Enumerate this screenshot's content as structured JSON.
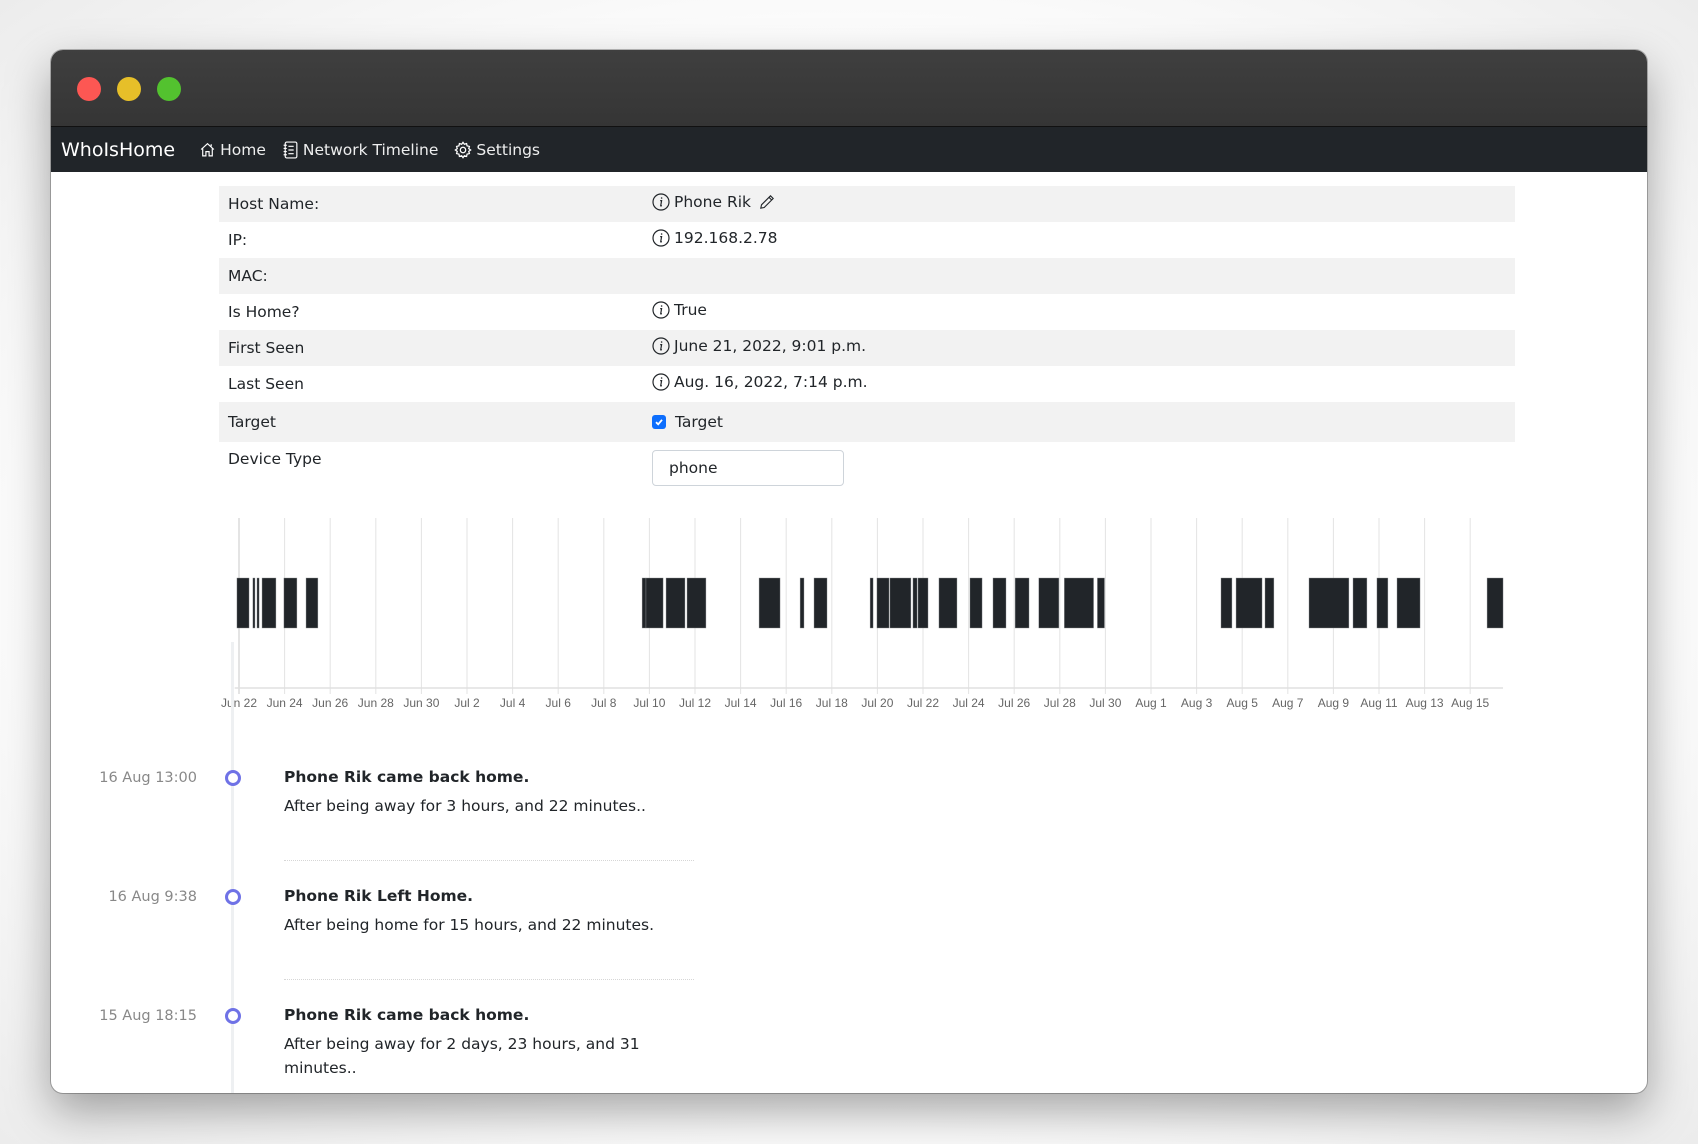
{
  "window": {
    "traffic_lights": [
      "close",
      "minimize",
      "maximize"
    ]
  },
  "navbar": {
    "brand": "WhoIsHome",
    "items": [
      {
        "label": "Home",
        "icon": "house-icon"
      },
      {
        "label": "Network Timeline",
        "icon": "journal-list-icon"
      },
      {
        "label": "Settings",
        "icon": "gear-icon"
      }
    ]
  },
  "device": {
    "rows": [
      {
        "label": "Host Name:",
        "value": "Phone Rik",
        "info": true,
        "editable": true
      },
      {
        "label": "IP:",
        "value": "192.168.2.78",
        "info": true
      },
      {
        "label": "MAC:",
        "value": ""
      },
      {
        "label": "Is Home?",
        "value": "True",
        "info": true
      },
      {
        "label": "First Seen",
        "value": "June 21, 2022, 9:01 p.m.",
        "info": true
      },
      {
        "label": "Last Seen",
        "value": "Aug. 16, 2022, 7:14 p.m.",
        "info": true
      }
    ],
    "target": {
      "label": "Target",
      "checkbox_label": "Target",
      "checked": true
    },
    "device_type": {
      "label": "Device Type",
      "value": "phone"
    }
  },
  "chart_data": {
    "type": "timeline",
    "title": "",
    "xlabel": "",
    "ylabel": "",
    "x_unit": "days since Jun 22, 2022",
    "xlim": [
      -0.1,
      55.2
    ],
    "grid": true,
    "tick_labels": [
      "Jun 22",
      "Jun 24",
      "Jun 26",
      "Jun 28",
      "Jun 30",
      "Jul 2",
      "Jul 4",
      "Jul 6",
      "Jul 8",
      "Jul 10",
      "Jul 12",
      "Jul 14",
      "Jul 16",
      "Jul 18",
      "Jul 20",
      "Jul 22",
      "Jul 24",
      "Jul 26",
      "Jul 28",
      "Jul 30",
      "Aug 1",
      "Aug 3",
      "Aug 5",
      "Aug 7",
      "Aug 9",
      "Aug 11",
      "Aug 13",
      "Aug 15"
    ],
    "tick_values": [
      0,
      2,
      4,
      6,
      8,
      10,
      12,
      14,
      16,
      18,
      20,
      22,
      24,
      26,
      28,
      30,
      32,
      34,
      36,
      38,
      40,
      42,
      44,
      46,
      48,
      50,
      52,
      54
    ],
    "series": [
      {
        "name": "home",
        "intervals": [
          [
            -0.09,
            0.44
          ],
          [
            0.61,
            0.7
          ],
          [
            0.79,
            0.88
          ],
          [
            1.01,
            1.62
          ],
          [
            1.97,
            2.54
          ],
          [
            2.94,
            3.46
          ],
          [
            17.68,
            17.85
          ],
          [
            17.85,
            18.6
          ],
          [
            18.73,
            19.56
          ],
          [
            19.65,
            20.48
          ],
          [
            22.81,
            23.73
          ],
          [
            24.61,
            24.78
          ],
          [
            25.22,
            25.79
          ],
          [
            27.68,
            27.81
          ],
          [
            27.98,
            28.51
          ],
          [
            28.55,
            29.47
          ],
          [
            29.56,
            29.74
          ],
          [
            29.78,
            30.22
          ],
          [
            30.7,
            31.49
          ],
          [
            32.06,
            32.59
          ],
          [
            33.07,
            33.64
          ],
          [
            34.04,
            34.65
          ],
          [
            35.08,
            35.96
          ],
          [
            36.2,
            37.48
          ],
          [
            37.65,
            37.96
          ],
          [
            43.07,
            43.55
          ],
          [
            43.73,
            44.87
          ],
          [
            45.0,
            45.39
          ],
          [
            46.93,
            48.68
          ],
          [
            48.86,
            49.47
          ],
          [
            49.91,
            50.39
          ],
          [
            50.79,
            51.8
          ],
          [
            54.74,
            55.44
          ]
        ]
      }
    ]
  },
  "timeline": {
    "events": [
      {
        "time": "16 Aug 13:00",
        "title": "Phone Rik came back home.",
        "body": "After being away for 3 hours, and 22 minutes.."
      },
      {
        "time": "16 Aug 9:38",
        "title": "Phone Rik Left Home.",
        "body": "After being home for 15 hours, and 22 minutes."
      },
      {
        "time": "15 Aug 18:15",
        "title": "Phone Rik came back home.",
        "body": "After being away for 2 days, 23 hours, and 31 minutes.."
      }
    ]
  },
  "colors": {
    "navbar": "#212529",
    "bar": "#212529",
    "timeline_dot": "#6f72e6",
    "checkbox": "#0d6efd"
  }
}
